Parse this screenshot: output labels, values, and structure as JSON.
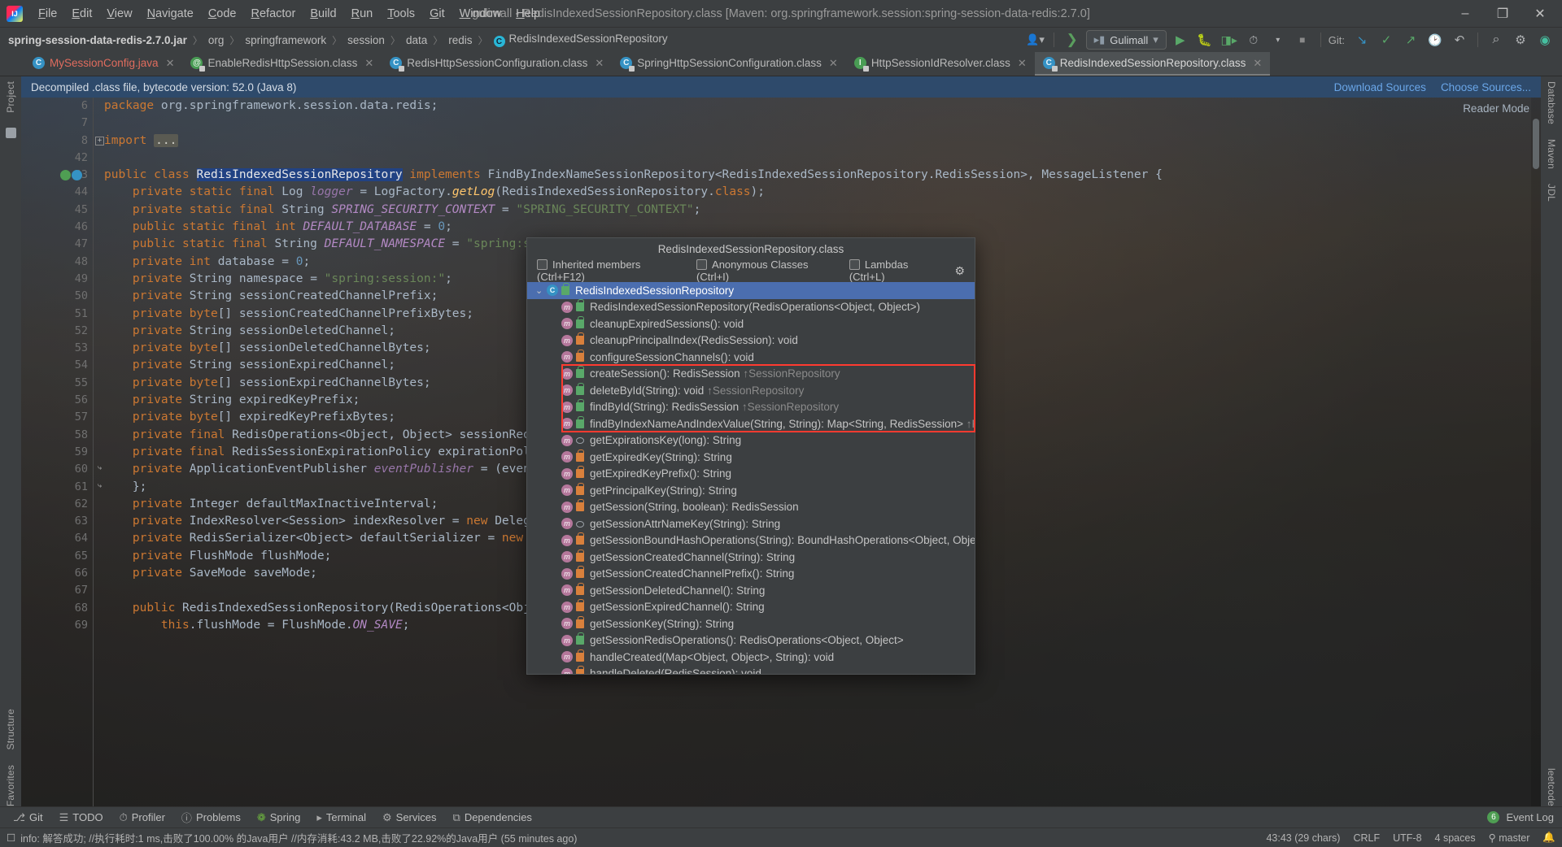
{
  "window": {
    "title": "gulimall - RedisIndexedSessionRepository.class [Maven: org.springframework.session:spring-session-data-redis:2.7.0]",
    "minimize": "–",
    "maximize": "❐",
    "close": "✕"
  },
  "menu": {
    "items": [
      "File",
      "Edit",
      "View",
      "Navigate",
      "Code",
      "Refactor",
      "Build",
      "Run",
      "Tools",
      "Git",
      "Window",
      "Help"
    ]
  },
  "breadcrumb": {
    "items": [
      "spring-session-data-redis-2.7.0.jar",
      "org",
      "springframework",
      "session",
      "data",
      "redis",
      "RedisIndexedSessionRepository"
    ],
    "separator": "〉",
    "class_icon_letter": "C"
  },
  "toolbar": {
    "run_config": "Gulimall",
    "run_config_caret": "▾",
    "git_label": "Git:",
    "buttons": [
      "profiler-icon",
      "build-icon",
      "run-icon",
      "debug-icon",
      "run-coverage-icon",
      "more-icon",
      "stop-icon"
    ],
    "git_buttons": [
      "update-project-icon",
      "commit-icon",
      "push-icon",
      "history-icon",
      "rollback-icon"
    ],
    "search_icon": "⌕",
    "settings_icon": "⚙"
  },
  "tabs": [
    {
      "label": "MySessionConfig.java",
      "icon": "class-icon",
      "kind": "c",
      "modified": true,
      "active": false
    },
    {
      "label": "EnableRedisHttpSession.class",
      "icon": "annotation-icon",
      "kind": "a",
      "modified": false,
      "active": false
    },
    {
      "label": "RedisHttpSessionConfiguration.class",
      "icon": "class-icon",
      "kind": "c",
      "modified": false,
      "active": false
    },
    {
      "label": "SpringHttpSessionConfiguration.class",
      "icon": "class-icon",
      "kind": "c",
      "modified": false,
      "active": false
    },
    {
      "label": "HttpSessionIdResolver.class",
      "icon": "interface-icon",
      "kind": "i",
      "modified": false,
      "active": false
    },
    {
      "label": "RedisIndexedSessionRepository.class",
      "icon": "class-icon",
      "kind": "c",
      "modified": false,
      "active": true
    }
  ],
  "notification": {
    "message": "Decompiled .class file, bytecode version: 52.0 (Java 8)",
    "download_sources": "Download Sources",
    "choose_sources": "Choose Sources...",
    "reader_mode": "Reader Mode"
  },
  "editor": {
    "lines": [
      {
        "n": "6",
        "html": "<span class=\"kw\">package</span> <span class=\"plain\">org.springframework.session.data.redis</span><span class=\"plain\">;</span>"
      },
      {
        "n": "7",
        "html": ""
      },
      {
        "n": "8",
        "html": "<span class=\"kw\">import</span> <span class=\"foldph\">...</span>",
        "fold": true
      },
      {
        "n": "42",
        "html": ""
      },
      {
        "n": "43",
        "html": "<span class=\"kw\">public class</span> <span class=\"sel\">RedisIndexedSessionRepository</span> <span class=\"kw\">implements</span> <span class=\"ty\">FindByIndexNameSessionRepository</span><span class=\"plain\">&lt;</span><span class=\"ty\">RedisIndexedSessionRepository.RedisSession</span><span class=\"plain\">&gt;, </span><span class=\"ty\">MessageListener</span> <span class=\"plain\">{</span>",
        "marks": true,
        "caret": true
      },
      {
        "n": "44",
        "html": "    <span class=\"kw\">private static final</span> <span class=\"ty\">Log</span> <span class=\"fld\">logger</span> <span class=\"plain\">=</span> <span class=\"ty\">LogFactory</span><span class=\"plain\">.</span><span class=\"mth\">getLog</span><span class=\"plain\">(</span><span class=\"ty\">RedisIndexedSessionRepository</span><span class=\"plain\">.</span><span class=\"kw\">class</span><span class=\"plain\">);</span>"
      },
      {
        "n": "45",
        "html": "    <span class=\"kw\">private static final</span> <span class=\"ty\">String</span> <span class=\"sfld\">SPRING_SECURITY_CONTEXT</span> <span class=\"plain\">=</span> <span class=\"str\">\"SPRING_SECURITY_CONTEXT\"</span><span class=\"plain\">;</span>"
      },
      {
        "n": "46",
        "html": "    <span class=\"kw\">public static final</span> <span class=\"kw\">int</span> <span class=\"sfld\">DEFAULT_DATABASE</span> <span class=\"plain\">=</span> <span class=\"num\">0</span><span class=\"plain\">;</span>"
      },
      {
        "n": "47",
        "html": "    <span class=\"kw\">public static final</span> <span class=\"ty\">String</span> <span class=\"sfld\">DEFAULT_NAMESPACE</span> <span class=\"plain\">=</span> <span class=\"str\">\"spring:session\"</span><span class=\"plain\">;</span>"
      },
      {
        "n": "48",
        "html": "    <span class=\"kw\">private</span> <span class=\"kw\">int</span> <span class=\"plain\">database =</span> <span class=\"num\">0</span><span class=\"plain\">;</span>"
      },
      {
        "n": "49",
        "html": "    <span class=\"kw\">private</span> <span class=\"ty\">String</span> <span class=\"plain\">namespace =</span> <span class=\"str\">\"spring:session:\"</span><span class=\"plain\">;</span>"
      },
      {
        "n": "50",
        "html": "    <span class=\"kw\">private</span> <span class=\"ty\">String</span> <span class=\"plain\">sessionCreatedChannelPrefix;</span>"
      },
      {
        "n": "51",
        "html": "    <span class=\"kw\">private</span> <span class=\"kw\">byte</span><span class=\"plain\">[] sessionCreatedChannelPrefixBytes;</span>"
      },
      {
        "n": "52",
        "html": "    <span class=\"kw\">private</span> <span class=\"ty\">String</span> <span class=\"plain\">sessionDeletedChannel;</span>"
      },
      {
        "n": "53",
        "html": "    <span class=\"kw\">private</span> <span class=\"kw\">byte</span><span class=\"plain\">[] sessionDeletedChannelBytes;</span>"
      },
      {
        "n": "54",
        "html": "    <span class=\"kw\">private</span> <span class=\"ty\">String</span> <span class=\"plain\">sessionExpiredChannel;</span>"
      },
      {
        "n": "55",
        "html": "    <span class=\"kw\">private</span> <span class=\"kw\">byte</span><span class=\"plain\">[] sessionExpiredChannelBytes;</span>"
      },
      {
        "n": "56",
        "html": "    <span class=\"kw\">private</span> <span class=\"ty\">String</span> <span class=\"plain\">expiredKeyPrefix;</span>"
      },
      {
        "n": "57",
        "html": "    <span class=\"kw\">private</span> <span class=\"kw\">byte</span><span class=\"plain\">[] expiredKeyPrefixBytes;</span>"
      },
      {
        "n": "58",
        "html": "    <span class=\"kw\">private final</span> <span class=\"ty\">RedisOperations</span><span class=\"plain\">&lt;</span><span class=\"ty\">Object</span><span class=\"plain\">, </span><span class=\"ty\">Object</span><span class=\"plain\">&gt; sessionRedisOperations;</span>"
      },
      {
        "n": "59",
        "html": "    <span class=\"kw\">private final</span> <span class=\"ty\">RedisSessionExpirationPolicy</span> <span class=\"plain\">expirationPolicy;</span>"
      },
      {
        "n": "60",
        "html": "    <span class=\"kw\">private</span> <span class=\"ty\">ApplicationEventPublisher</span> <span class=\"fld\">eventPublisher</span> <span class=\"plain\">= (event) -&gt; {</span>",
        "guide": true
      },
      {
        "n": "61",
        "html": "    <span class=\"plain\">};</span>",
        "guide": true
      },
      {
        "n": "62",
        "html": "    <span class=\"kw\">private</span> <span class=\"ty\">Integer</span> <span class=\"plain\">defaultMaxInactiveInterval;</span>"
      },
      {
        "n": "63",
        "html": "    <span class=\"kw\">private</span> <span class=\"ty\">IndexResolver</span><span class=\"plain\">&lt;</span><span class=\"ty\">Session</span><span class=\"plain\">&gt; indexResolver =</span> <span class=\"kw\">new</span> <span class=\"ty\">DelegatingIndexResolver</span><span class=\"plain\">(</span><span class=\"kw\">new</span> <span class=\"ty\">PrincipalNameIndexResolver</span><span class=\"plain\">());</span>"
      },
      {
        "n": "64",
        "html": "    <span class=\"kw\">private</span> <span class=\"ty\">RedisSerializer</span><span class=\"plain\">&lt;</span><span class=\"ty\">Object</span><span class=\"plain\">&gt; defaultSerializer =</span> <span class=\"kw\">new</span> <span class=\"ty\">JdkSerializationRedisSerializer</span><span class=\"plain\">();</span>"
      },
      {
        "n": "65",
        "html": "    <span class=\"kw\">private</span> <span class=\"ty\">FlushMode</span> <span class=\"plain\">flushMode;</span>"
      },
      {
        "n": "66",
        "html": "    <span class=\"kw\">private</span> <span class=\"ty\">SaveMode</span> <span class=\"plain\">saveMode;</span>"
      },
      {
        "n": "67",
        "html": ""
      },
      {
        "n": "68",
        "html": "    <span class=\"kw\">public</span> <span class=\"ty\">RedisIndexedSessionRepository</span><span class=\"plain\">(</span><span class=\"ty\">RedisOperations</span><span class=\"plain\">&lt;</span><span class=\"ty\">Object</span><span class=\"plain\">, </span><span class=\"ty\">Object</span><span class=\"plain\">&gt; sessionRedisOperations) {</span>"
      },
      {
        "n": "69",
        "html": "        <span class=\"kw\">this</span><span class=\"plain\">.flushMode =</span> <span class=\"ty\">FlushMode</span><span class=\"plain\">.</span><span class=\"sfld\">ON_SAVE</span><span class=\"plain\">;</span>"
      }
    ]
  },
  "popup": {
    "title": "RedisIndexedSessionRepository.class",
    "filters": [
      {
        "label": "Inherited members (Ctrl+F12)",
        "checked": false
      },
      {
        "label": "Anonymous Classes (Ctrl+I)",
        "checked": false
      },
      {
        "label": "Lambdas (Ctrl+L)",
        "checked": false
      }
    ],
    "gear_icon": "⚙",
    "chevron": "⌄",
    "root": {
      "label": "RedisIndexedSessionRepository",
      "icon": "class-icon",
      "visibility": "pub"
    },
    "members": [
      {
        "label": "RedisIndexedSessionRepository(RedisOperations<Object, Object>)",
        "visibility": "pub",
        "override": ""
      },
      {
        "label": "cleanupExpiredSessions(): void",
        "visibility": "pub",
        "override": ""
      },
      {
        "label": "cleanupPrincipalIndex(RedisSession): void",
        "visibility": "priv",
        "override": ""
      },
      {
        "label": "configureSessionChannels(): void",
        "visibility": "priv",
        "override": ""
      },
      {
        "label": "createSession(): RedisSession",
        "visibility": "pub",
        "override": "↑SessionRepository",
        "highlight": true
      },
      {
        "label": "deleteById(String): void",
        "visibility": "pub",
        "override": "↑SessionRepository",
        "highlight": true
      },
      {
        "label": "findById(String): RedisSession",
        "visibility": "pub",
        "override": "↑SessionRepository",
        "highlight": true
      },
      {
        "label": "findByIndexNameAndIndexValue(String, String): Map<String, RedisSession>",
        "visibility": "pub",
        "override": "↑Fi",
        "highlight": true
      },
      {
        "label": "getExpirationsKey(long): String",
        "visibility": "pkg",
        "override": ""
      },
      {
        "label": "getExpiredKey(String): String",
        "visibility": "priv",
        "override": ""
      },
      {
        "label": "getExpiredKeyPrefix(): String",
        "visibility": "priv",
        "override": ""
      },
      {
        "label": "getPrincipalKey(String): String",
        "visibility": "priv",
        "override": ""
      },
      {
        "label": "getSession(String, boolean): RedisSession",
        "visibility": "priv",
        "override": ""
      },
      {
        "label": "getSessionAttrNameKey(String): String",
        "visibility": "pkg",
        "override": ""
      },
      {
        "label": "getSessionBoundHashOperations(String): BoundHashOperations<Object, Object, Object>",
        "visibility": "priv",
        "override": ""
      },
      {
        "label": "getSessionCreatedChannel(String): String",
        "visibility": "priv",
        "override": ""
      },
      {
        "label": "getSessionCreatedChannelPrefix(): String",
        "visibility": "priv",
        "override": ""
      },
      {
        "label": "getSessionDeletedChannel(): String",
        "visibility": "priv",
        "override": ""
      },
      {
        "label": "getSessionExpiredChannel(): String",
        "visibility": "priv",
        "override": ""
      },
      {
        "label": "getSessionKey(String): String",
        "visibility": "priv",
        "override": ""
      },
      {
        "label": "getSessionRedisOperations(): RedisOperations<Object, Object>",
        "visibility": "pub",
        "override": ""
      },
      {
        "label": "handleCreated(Map<Object, Object>, String): void",
        "visibility": "priv",
        "override": ""
      },
      {
        "label": "handleDeleted(RedisSession): void",
        "visibility": "priv",
        "override": ""
      }
    ]
  },
  "tool_windows": {
    "left": [
      "Project",
      "Structure",
      "Favorites"
    ],
    "right": [
      "Database",
      "Maven",
      "JDL",
      "leetcode"
    ]
  },
  "bottom_bar": {
    "items": [
      {
        "label": "Git",
        "icon": "git-icon"
      },
      {
        "label": "TODO",
        "icon": "todo-icon"
      },
      {
        "label": "Profiler",
        "icon": "profiler-icon"
      },
      {
        "label": "Problems",
        "icon": "problems-icon"
      },
      {
        "label": "Spring",
        "icon": "spring-icon"
      },
      {
        "label": "Terminal",
        "icon": "terminal-icon"
      },
      {
        "label": "Services",
        "icon": "services-icon"
      },
      {
        "label": "Dependencies",
        "icon": "dependencies-icon"
      }
    ],
    "event_log": "Event Log",
    "event_count": "6"
  },
  "status_bar": {
    "message": "info: 解答成功; //执行耗时:1 ms,击败了100.00% 的Java用户 //内存消耗:43.2 MB,击败了22.92%的Java用户 (55 minutes ago)",
    "position": "43:43 (29 chars)",
    "line_separator": "CRLF",
    "encoding": "UTF-8",
    "indent": "4 spaces",
    "branch": "master",
    "lock_icon": "ὑ2"
  }
}
